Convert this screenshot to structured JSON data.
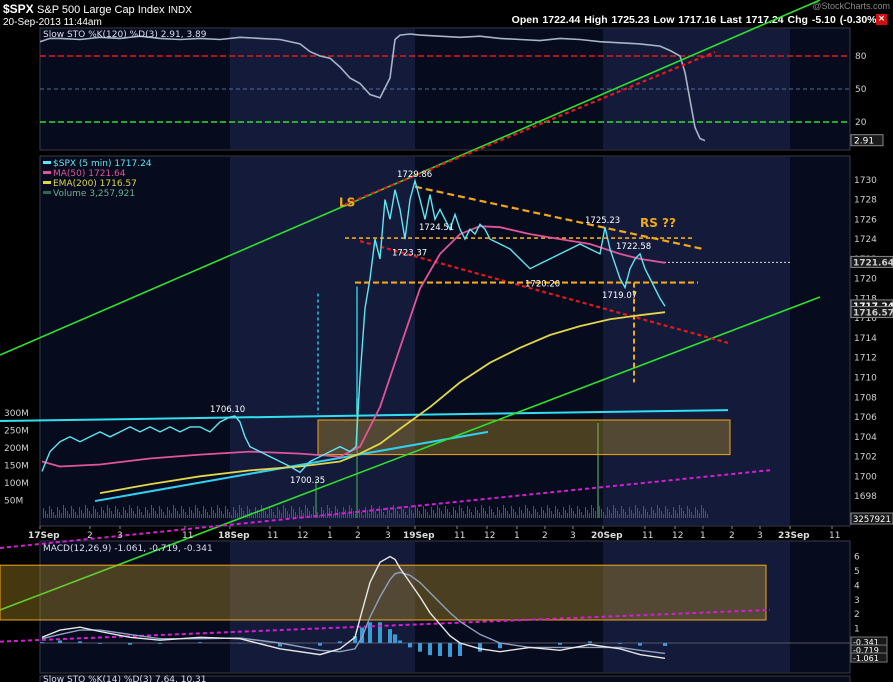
{
  "header": {
    "symbol": "$SPX",
    "name": "S&P 500 Large Cap Index",
    "exchange": "INDX",
    "datetime": "20-Sep-2013 11:44am",
    "quote": "Open 1722.44  High 1725.23  Low 1717.16  Last 1717.24  Chg -5.10 (-0.30%)",
    "watermark": "@StockCharts.com"
  },
  "colors": {
    "bg": "#000000",
    "panel": "#070b1e",
    "shade": "#141a3a",
    "price": "#5fe6f0",
    "ma50": "#e0559a",
    "ema200": "#e0d64a",
    "green": "#2ee02e",
    "red": "#e01a1a",
    "orange": "#f0a818",
    "magenta": "#d020d0",
    "axis": "#cfcfcf"
  },
  "chart_data": [
    {
      "type": "line",
      "panel": "slow-sto-top",
      "legend": "Slow STO %K(120) %D(3) 2.91, 3.89",
      "ylim": [
        0,
        100
      ],
      "y_ticks": [
        20,
        50,
        80
      ],
      "last_label": "2.91",
      "x": [
        0,
        10,
        20,
        40,
        60,
        80,
        100,
        120,
        140,
        160,
        180,
        200,
        220,
        240,
        260,
        270,
        280,
        290,
        300,
        310,
        320,
        330,
        340,
        350,
        355,
        360,
        370,
        380,
        400,
        420,
        440,
        460,
        480,
        500,
        520,
        540,
        560,
        580,
        600,
        620,
        630,
        640,
        645,
        650,
        655,
        660,
        665
      ],
      "values": [
        93,
        96,
        96,
        95,
        97,
        96,
        98,
        96,
        95,
        96,
        95,
        97,
        96,
        95,
        91,
        84,
        80,
        78,
        70,
        60,
        55,
        45,
        42,
        60,
        95,
        99,
        100,
        99,
        98,
        97,
        98,
        96,
        95,
        94,
        96,
        95,
        93,
        92,
        91,
        89,
        85,
        80,
        65,
        40,
        15,
        5,
        3
      ]
    },
    {
      "type": "line",
      "panel": "price",
      "legend": [
        "$SPX (5 min) 1717.24",
        "MA(50) 1721.64",
        "EMA(200) 1716.57",
        "Volume 3,257,921"
      ],
      "ylim": [
        1697,
        1732
      ],
      "y_ticks": [
        1698,
        1700,
        1702,
        1704,
        1706,
        1708,
        1710,
        1712,
        1714,
        1716,
        1718,
        1720,
        1722,
        1724,
        1726,
        1728,
        1730
      ],
      "x_ticks": [
        {
          "x": 40,
          "label": "17Sep",
          "bold": true
        },
        {
          "x": 90,
          "label": "2"
        },
        {
          "x": 120,
          "label": "3"
        },
        {
          "x": 185,
          "label": "11"
        },
        {
          "x": 230,
          "label": "18Sep",
          "bold": true
        },
        {
          "x": 270,
          "label": "11"
        },
        {
          "x": 300,
          "label": "12"
        },
        {
          "x": 330,
          "label": "1"
        },
        {
          "x": 358,
          "label": "2"
        },
        {
          "x": 388,
          "label": "3"
        },
        {
          "x": 415,
          "label": "19Sep",
          "bold": true
        },
        {
          "x": 457,
          "label": "11"
        },
        {
          "x": 487,
          "label": "12"
        },
        {
          "x": 517,
          "label": "1"
        },
        {
          "x": 545,
          "label": "2"
        },
        {
          "x": 573,
          "label": "3"
        },
        {
          "x": 603,
          "label": "20Sep",
          "bold": true
        },
        {
          "x": 645,
          "label": "11"
        },
        {
          "x": 675,
          "label": "12"
        },
        {
          "x": 703,
          "label": "1"
        },
        {
          "x": 732,
          "label": "2"
        },
        {
          "x": 760,
          "label": "3"
        },
        {
          "x": 790,
          "label": "23Sep",
          "bold": true
        },
        {
          "x": 832,
          "label": "11"
        }
      ],
      "price_x": [
        42,
        50,
        60,
        70,
        80,
        90,
        100,
        110,
        120,
        130,
        140,
        150,
        160,
        170,
        180,
        190,
        200,
        210,
        220,
        230,
        235,
        240,
        245,
        250,
        260,
        270,
        280,
        290,
        300,
        310,
        320,
        330,
        340,
        350,
        356,
        360,
        365,
        370,
        375,
        380,
        385,
        390,
        395,
        400,
        405,
        410,
        415,
        420,
        425,
        430,
        435,
        440,
        445,
        450,
        455,
        460,
        465,
        470,
        475,
        480,
        485,
        490,
        500,
        510,
        520,
        530,
        540,
        550,
        560,
        570,
        580,
        590,
        600,
        605,
        610,
        615,
        620,
        625,
        630,
        635,
        640,
        645,
        650,
        655,
        660,
        665
      ],
      "price": [
        1700.5,
        1702.5,
        1703.5,
        1704,
        1703.5,
        1704,
        1704.5,
        1704,
        1704.5,
        1705,
        1704.5,
        1705,
        1704.5,
        1705,
        1704.5,
        1705,
        1705,
        1704.5,
        1705.5,
        1706,
        1706.1,
        1705.5,
        1704,
        1703,
        1702.5,
        1702,
        1701.5,
        1701,
        1700.4,
        1701.5,
        1702,
        1702.5,
        1703,
        1702.5,
        1703,
        1710,
        1717,
        1720,
        1724,
        1722,
        1728,
        1726,
        1729,
        1727,
        1724,
        1728,
        1729.9,
        1728,
        1726,
        1728.5,
        1726,
        1727,
        1726,
        1725,
        1726.5,
        1725,
        1724,
        1725,
        1724.5,
        1725.5,
        1725,
        1724,
        1723.5,
        1723,
        1722,
        1721,
        1721.5,
        1722,
        1722.5,
        1723,
        1723.5,
        1723,
        1722.5,
        1725.2,
        1723,
        1721.5,
        1720,
        1719.1,
        1721,
        1722,
        1722.5,
        1721,
        1720,
        1719,
        1718,
        1717.2
      ],
      "price_last_label": "1717.24",
      "ma50_x": [
        42,
        60,
        100,
        150,
        200,
        250,
        300,
        340,
        360,
        380,
        400,
        420,
        440,
        460,
        480,
        500,
        530,
        560,
        590,
        620,
        640,
        665
      ],
      "ma50": [
        1701.5,
        1701,
        1701.2,
        1701.8,
        1702.2,
        1702.5,
        1702.3,
        1702,
        1703,
        1707,
        1713,
        1719,
        1722.5,
        1724.5,
        1725.3,
        1725.2,
        1724.5,
        1724,
        1723.5,
        1722.5,
        1722,
        1721.6
      ],
      "ma50_last_label": "1721.64",
      "ema200_x": [
        100,
        150,
        200,
        250,
        300,
        340,
        360,
        380,
        400,
        430,
        460,
        490,
        520,
        550,
        580,
        610,
        640,
        665
      ],
      "ema200": [
        1698.3,
        1699.2,
        1700,
        1700.6,
        1701,
        1701.5,
        1702.3,
        1703.3,
        1704.8,
        1707,
        1709.5,
        1711.5,
        1713,
        1714.3,
        1715.2,
        1715.9,
        1716.3,
        1716.6
      ],
      "ema200_last_label": "1716.57",
      "annotations": [
        {
          "x": 228,
          "y": 1706.1,
          "text": "1706.10",
          "pos": "above"
        },
        {
          "x": 308,
          "y": 1700.35,
          "text": "1700.35",
          "pos": "below"
        },
        {
          "x": 415,
          "y": 1729.86,
          "text": "1729.86",
          "pos": "above"
        },
        {
          "x": 410,
          "y": 1723.37,
          "text": "1723.37",
          "pos": "below"
        },
        {
          "x": 437,
          "y": 1724.51,
          "text": "1724.51",
          "pos": "above"
        },
        {
          "x": 543,
          "y": 1720.2,
          "text": "1720.20",
          "pos": "below"
        },
        {
          "x": 603,
          "y": 1725.23,
          "text": "1725.23",
          "pos": "above"
        },
        {
          "x": 634,
          "y": 1722.58,
          "text": "1722.58",
          "pos": "above"
        },
        {
          "x": 620,
          "y": 1719.07,
          "text": "1719.07",
          "pos": "below"
        }
      ],
      "labels": [
        {
          "x": 347,
          "y": 1727.3,
          "text": "LS"
        },
        {
          "x": 648,
          "y": 1725.2,
          "text": "RS ??"
        }
      ],
      "volume_ticks": [
        {
          "v": 300,
          "label": "300M"
        },
        {
          "v": 250,
          "label": "250M"
        },
        {
          "v": 200,
          "label": "200M"
        },
        {
          "v": 150,
          "label": "150M"
        },
        {
          "v": 100,
          "label": "100M"
        },
        {
          "v": 50,
          "label": "50M"
        }
      ],
      "volume_last_label": "3257921"
    },
    {
      "type": "line",
      "panel": "macd",
      "legend": "MACD(12,26,9) -1.061, -0.719, -0.341",
      "ylim": [
        -1.8,
        6.8
      ],
      "y_ticks": [
        -1,
        0,
        1,
        2,
        3,
        4,
        5,
        6
      ],
      "x": [
        42,
        60,
        80,
        100,
        130,
        160,
        200,
        240,
        280,
        320,
        340,
        355,
        362,
        370,
        380,
        390,
        395,
        400,
        410,
        420,
        430,
        440,
        450,
        460,
        480,
        500,
        530,
        560,
        590,
        620,
        640,
        665
      ],
      "macd": [
        0.4,
        0.9,
        1.1,
        0.8,
        0.4,
        0.2,
        0.4,
        0.3,
        -0.4,
        -0.8,
        -0.4,
        0.4,
        2.2,
        4.2,
        5.6,
        6.0,
        5.8,
        5.2,
        4.2,
        3.2,
        2.1,
        1.3,
        0.5,
        0,
        -0.4,
        -0.6,
        -0.3,
        -0.5,
        -0.1,
        -0.4,
        -0.8,
        -1.06
      ],
      "signal": [
        0.3,
        0.6,
        0.9,
        0.9,
        0.6,
        0.3,
        0.3,
        0.35,
        0,
        -0.5,
        -0.6,
        -0.4,
        0.4,
        1.8,
        3.2,
        4.4,
        4.8,
        4.9,
        4.7,
        4.2,
        3.5,
        2.8,
        2.1,
        1.5,
        0.6,
        0,
        -0.3,
        -0.3,
        -0.3,
        -0.3,
        -0.5,
        -0.72
      ],
      "last_labels": [
        "-0.341",
        "-0.719",
        "-1.061"
      ]
    },
    {
      "type": "line",
      "panel": "slow-sto-bottom",
      "legend": "Slow STO %K(14) %D(3) 7.64, 10.31"
    }
  ]
}
